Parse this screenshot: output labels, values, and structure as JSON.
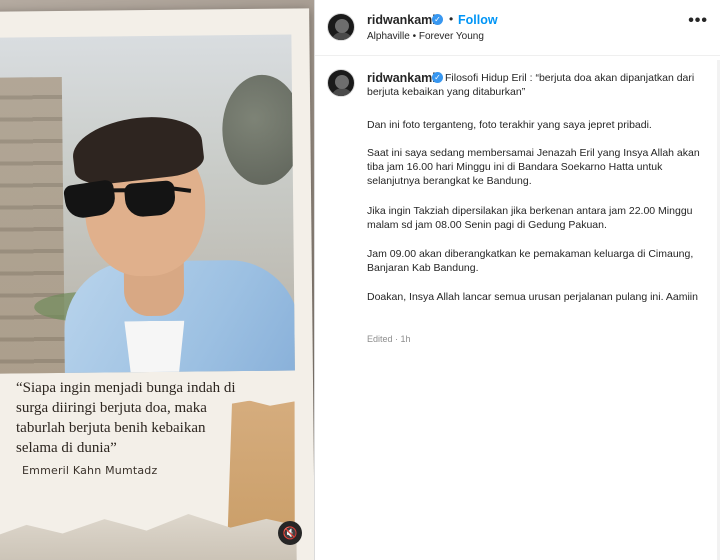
{
  "post": {
    "username": "ridwankamil",
    "verified_badge": "✓",
    "dot": "•",
    "follow_label": "Follow",
    "music": "Alphaville • Forever Young",
    "more_icon": "•••"
  },
  "media": {
    "quote": "“Siapa ingin menjadi bunga indah di surga diiringi berjuta doa, maka taburlah berjuta benih kebaikan selama di dunia”",
    "quote_author": "Emmeril Kahn Mumtadz",
    "mute_icon": "🔇"
  },
  "caption": {
    "username": "ridwankamil",
    "first_line": "Filosofi Hidup Eril : “berjuta doa akan dipanjatkan dari berjuta kebaikan yang ditaburkan”",
    "paragraphs": [
      "Dan ini foto terganteng, foto terakhir yang saya jepret pribadi.",
      "Saat ini saya sedang membersamai Jenazah Eril yang Insya Allah akan tiba jam 16.00 hari Minggu ini di Bandara Soekarno Hatta untuk selanjutnya berangkat ke Bandung.",
      "Jika ingin Takziah dipersilakan jika berkenan antara jam 22.00 Minggu malam sd jam 08.00 Senin pagi di Gedung Pakuan.",
      "Jam 09.00 akan diberangkatkan ke pemakaman keluarga di Cimaung, Banjaran Kab Bandung.",
      "Doakan, Insya Allah lancar semua urusan perjalanan pulang ini. Aamiin"
    ],
    "meta": "Edited · 1h"
  }
}
